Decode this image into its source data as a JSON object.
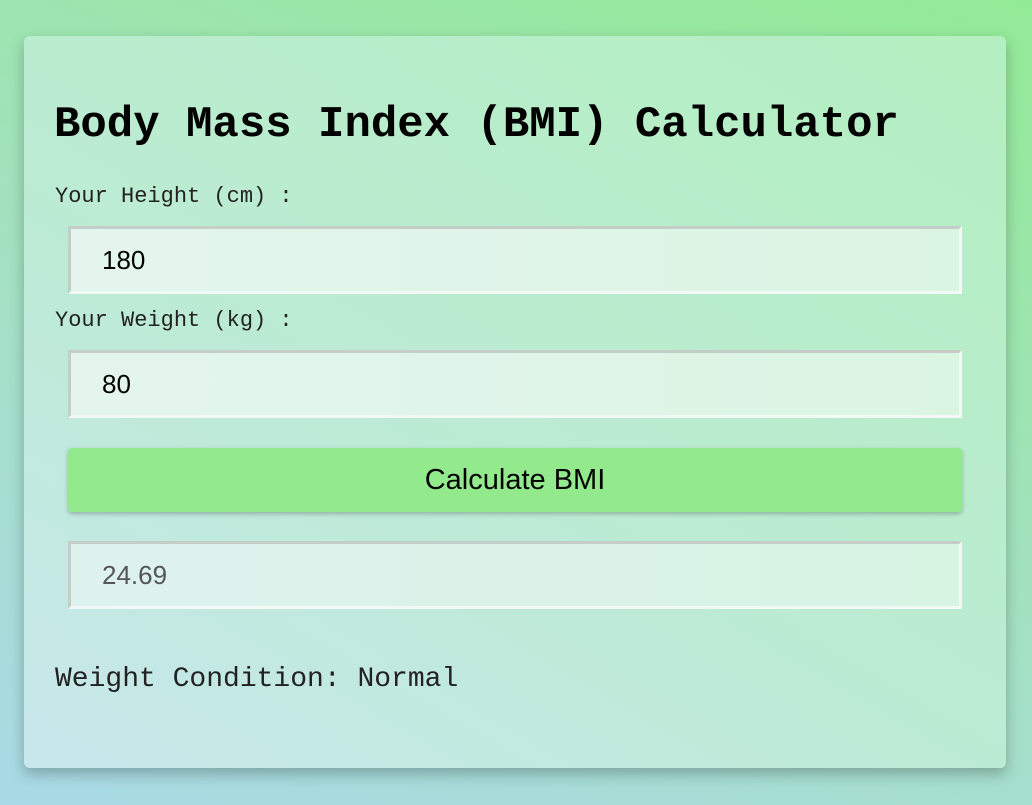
{
  "app": {
    "title": "Body Mass Index (BMI) Calculator"
  },
  "form": {
    "height_label": "Your Height (cm) :",
    "height_value": "180",
    "weight_label": "Your Weight (kg) :",
    "weight_value": "80",
    "calculate_label": "Calculate BMI",
    "result_value": "24.69"
  },
  "result": {
    "condition_text": "Weight Condition: Normal"
  },
  "colors": {
    "button": "#93ea8d",
    "background_green": "#93ea96",
    "background_blue": "#a9d9e6"
  }
}
